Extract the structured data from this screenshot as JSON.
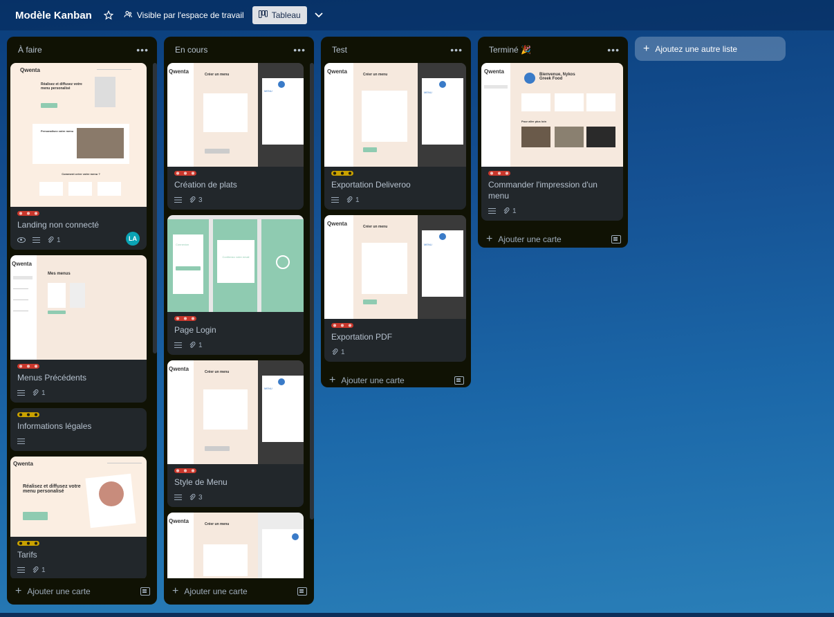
{
  "header": {
    "board_title": "Modèle Kanban",
    "visibility": "Visible par l'espace de travail",
    "view": "Tableau"
  },
  "lists": [
    {
      "title": "À faire",
      "cards": [
        {
          "title": "Landing non connecté",
          "labels": [
            "red"
          ],
          "attachments": "1",
          "avatar": "LA"
        },
        {
          "title": "Menus Précédents",
          "labels": [
            "red"
          ],
          "attachments": "1"
        },
        {
          "title": "Informations légales",
          "labels": [
            "yellow"
          ]
        },
        {
          "title": "Tarifs",
          "labels": [
            "yellow"
          ],
          "attachments": "1"
        }
      ],
      "add_card": "Ajouter une carte"
    },
    {
      "title": "En cours",
      "cards": [
        {
          "title": "Création de plats",
          "labels": [
            "red"
          ],
          "attachments": "3"
        },
        {
          "title": "Page Login",
          "labels": [
            "red"
          ],
          "attachments": "1"
        },
        {
          "title": "Style de Menu",
          "labels": [
            "red"
          ],
          "attachments": "3"
        }
      ],
      "add_card": "Ajouter une carte"
    },
    {
      "title": "Test",
      "cards": [
        {
          "title": "Exportation Deliveroo",
          "labels": [
            "yellow"
          ],
          "attachments": "1"
        },
        {
          "title": "Exportation PDF",
          "labels": [
            "red"
          ],
          "attachments": "1"
        }
      ],
      "add_card": "Ajouter une carte"
    },
    {
      "title": "Terminé 🎉",
      "cards": [
        {
          "title": "Commander l'impression d'un menu",
          "labels": [
            "red"
          ],
          "attachments": "1"
        }
      ],
      "add_card": "Ajouter une carte"
    }
  ],
  "add_list": "Ajoutez une autre liste",
  "mock_text": {
    "logo": "Qwenta",
    "create_menu": "Créer un menu",
    "menu": "MENU",
    "mes_menus": "Mes menus",
    "welcome": "Bienvenue, Nykos Greek Food",
    "hero": "Réalisez et diffusez votre menu personalisé",
    "perso": "Personalisez votre menu",
    "comment": "Comment créer votre menu ?",
    "connexion": "Connexion",
    "confirmez": "Confirmez votre email",
    "pour_aller": "Pour aller plus loin"
  },
  "colors": {
    "label_red": "#c9372c",
    "label_yellow": "#c9a100",
    "avatar": "#0aa3b4",
    "mint": "#8fcbb1"
  }
}
